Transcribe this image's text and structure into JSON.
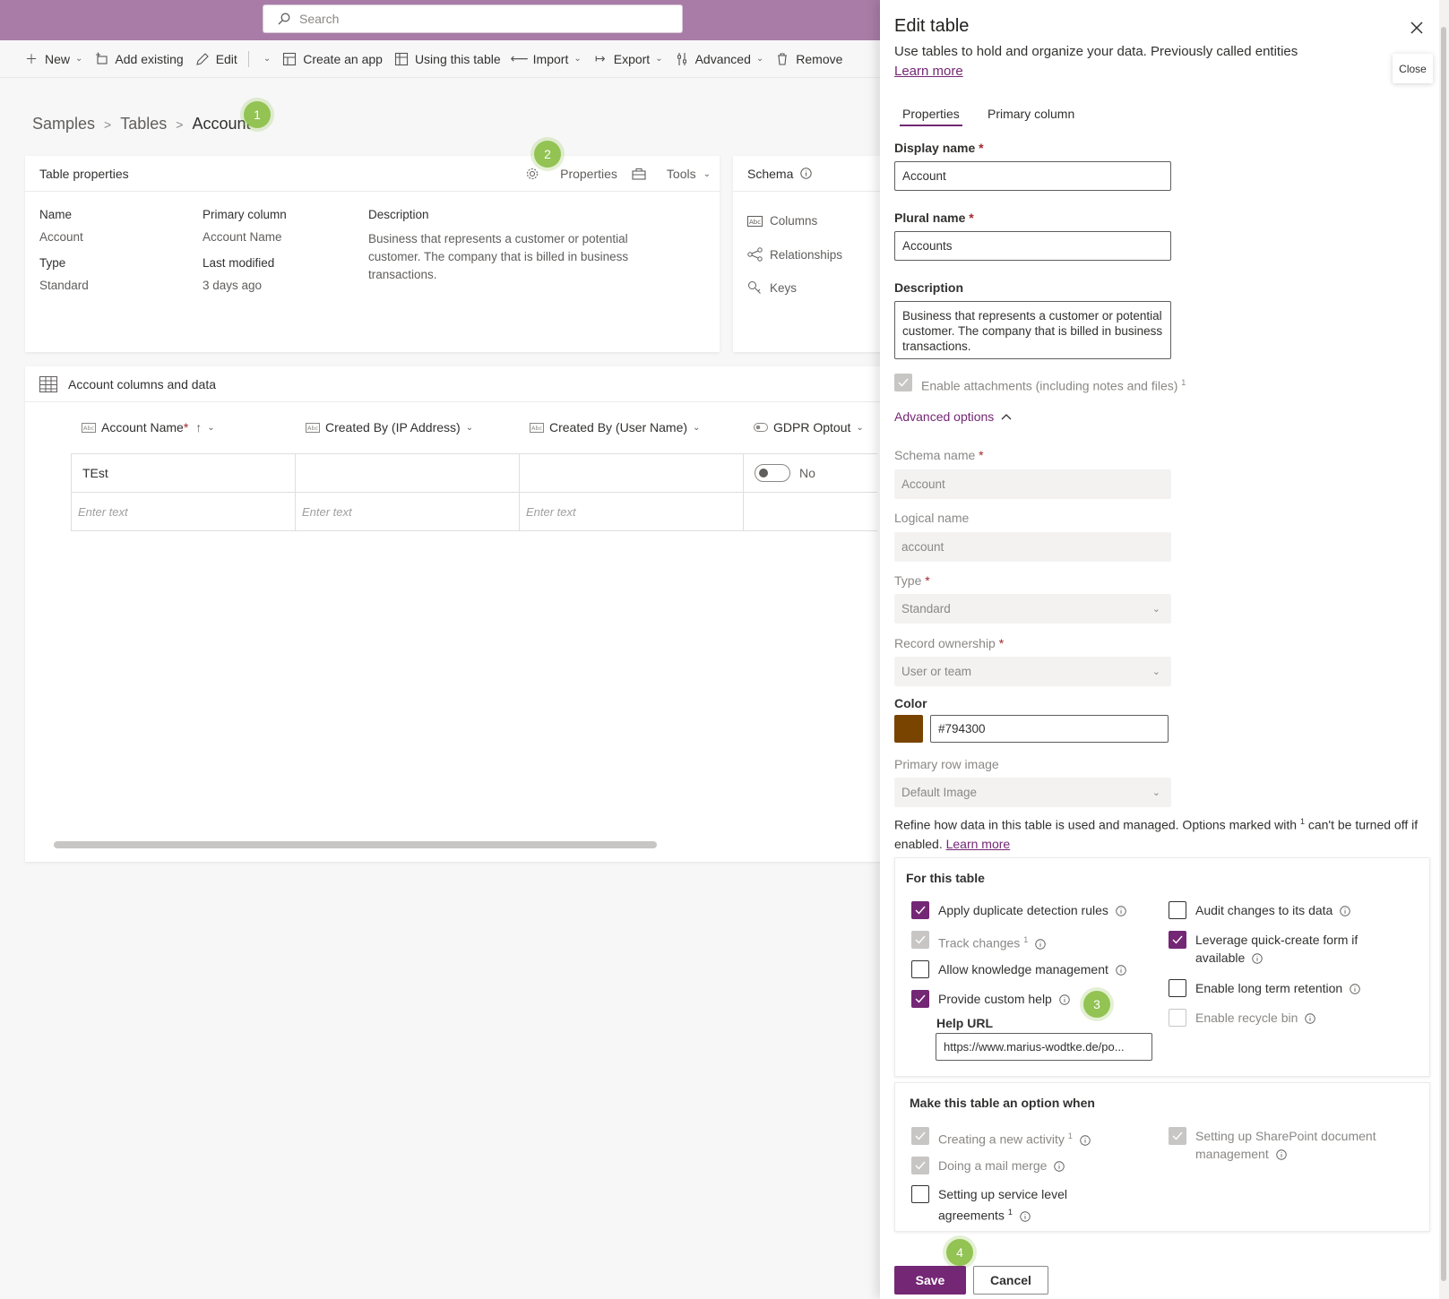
{
  "search": {
    "placeholder": "Search"
  },
  "toolbar": {
    "new": "New",
    "add_existing": "Add existing",
    "edit": "Edit",
    "create_app": "Create an app",
    "using_table": "Using this table",
    "import": "Import",
    "export": "Export",
    "advanced": "Advanced",
    "remove": "Remove"
  },
  "breadcrumb": [
    "Samples",
    "Tables",
    "Account"
  ],
  "badges": [
    "1",
    "2",
    "3",
    "4"
  ],
  "table_properties": {
    "title": "Table properties",
    "properties_btn": "Properties",
    "tools_btn": "Tools",
    "name_label": "Name",
    "name_value": "Account",
    "type_label": "Type",
    "type_value": "Standard",
    "primary_label": "Primary column",
    "primary_value": "Account Name",
    "modified_label": "Last modified",
    "modified_value": "3 days ago",
    "desc_label": "Description",
    "desc_value": "Business that represents a customer or potential customer. The company that is billed in business transactions."
  },
  "schema": {
    "title": "Schema",
    "items": [
      "Columns",
      "Relationships",
      "Keys"
    ]
  },
  "columns_data": {
    "title": "Account columns and data",
    "headers": [
      "Account Name",
      "Created By (IP Address)",
      "Created By (User Name)",
      "GDPR Optout"
    ],
    "row1": {
      "account_name": "TEst",
      "gdpr": "No"
    },
    "placeholder": "Enter text"
  },
  "panel": {
    "title": "Edit table",
    "subtitle": "Use tables to hold and organize your data. Previously called entities",
    "learn_more": "Learn more",
    "close_tip": "Close",
    "tabs": [
      "Properties",
      "Primary column"
    ],
    "display_name_label": "Display name",
    "display_name_value": "Account",
    "plural_name_label": "Plural name",
    "plural_name_value": "Accounts",
    "description_label": "Description",
    "description_value": "Business that represents a customer or potential customer. The company that is billed in business transactions.",
    "attachments_label": "Enable attachments (including notes and files)",
    "advanced_options": "Advanced options",
    "schema_name_label": "Schema name",
    "schema_name_value": "Account",
    "logical_name_label": "Logical name",
    "logical_name_value": "account",
    "type_label": "Type",
    "type_value": "Standard",
    "ownership_label": "Record ownership",
    "ownership_value": "User or team",
    "color_label": "Color",
    "color_value": "#794300",
    "primary_image_label": "Primary row image",
    "primary_image_value": "Default Image",
    "refine_text_a": "Refine how data in this table is used and managed. Options marked with",
    "refine_sup": "1",
    "refine_text_b": "can't be turned off if enabled.",
    "refine_learn": "Learn more",
    "for_table_title": "For this table",
    "opt_duplicate": "Apply duplicate detection rules",
    "opt_track": "Track changes",
    "opt_knowledge": "Allow knowledge management",
    "opt_custom_help": "Provide custom help",
    "help_url_label": "Help URL",
    "help_url_value": "https://www.marius-wodtke.de/po...",
    "opt_audit": "Audit changes to its data",
    "opt_quick_create": "Leverage quick-create form if available",
    "opt_long_term": "Enable long term retention",
    "opt_recycle": "Enable recycle bin",
    "option_when_title": "Make this table an option when",
    "opt_new_activity": "Creating a new activity",
    "opt_mail_merge": "Doing a mail merge",
    "opt_sla": "Setting up service level agreements",
    "opt_sharepoint": "Setting up SharePoint document management",
    "save": "Save",
    "cancel": "Cancel"
  },
  "colors": {
    "accent": "#742774",
    "header": "#a87ca6",
    "swatch": "#794300",
    "badge": "#92c353"
  }
}
